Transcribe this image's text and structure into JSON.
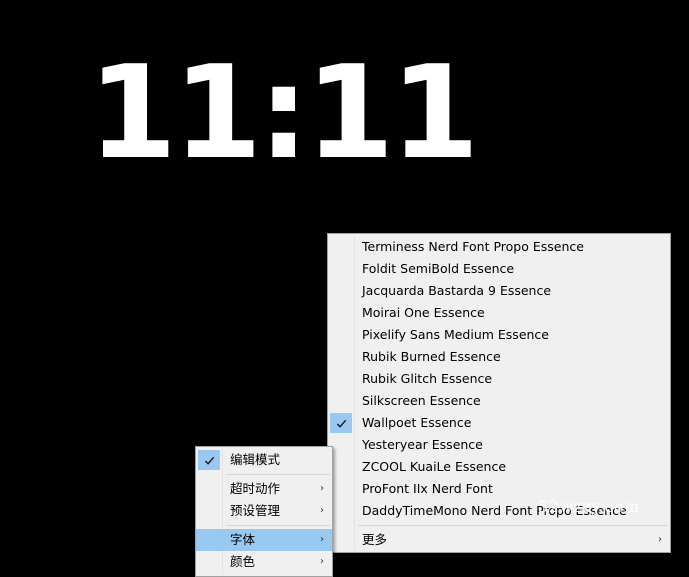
{
  "clock": {
    "time": "11:11"
  },
  "context_menu": {
    "items": [
      {
        "label": "编辑模式",
        "checked": true
      },
      {
        "label": "超时动作",
        "submenu": true
      },
      {
        "label": "预设管理",
        "submenu": true
      },
      {
        "label": "字体",
        "submenu": true,
        "selected": true
      },
      {
        "label": "颜色",
        "submenu": true
      }
    ]
  },
  "font_submenu": {
    "items": [
      {
        "label": "Terminess Nerd Font Propo Essence"
      },
      {
        "label": "Foldit SemiBold Essence"
      },
      {
        "label": "Jacquarda Bastarda 9 Essence"
      },
      {
        "label": "Moirai One Essence"
      },
      {
        "label": "Pixelify Sans Medium Essence"
      },
      {
        "label": "Rubik Burned Essence"
      },
      {
        "label": "Rubik Glitch Essence"
      },
      {
        "label": "Silkscreen Essence"
      },
      {
        "label": "Wallpoet Essence",
        "checked": true
      },
      {
        "label": "Yesteryear Essence"
      },
      {
        "label": "ZCOOL KuaiLe Essence"
      },
      {
        "label": "ProFont IIx Nerd Font"
      },
      {
        "label": "DaddyTimeMono Nerd Font Propo Essence"
      }
    ],
    "more_label": "更多"
  },
  "watermark": {
    "text": "52wzzy.com"
  },
  "colors": {
    "background": "#000000",
    "menu_bg": "#f0f0f0",
    "highlight": "#99c9f0"
  },
  "icons": {
    "check": "check-icon",
    "submenu": "chevron-right-icon"
  }
}
